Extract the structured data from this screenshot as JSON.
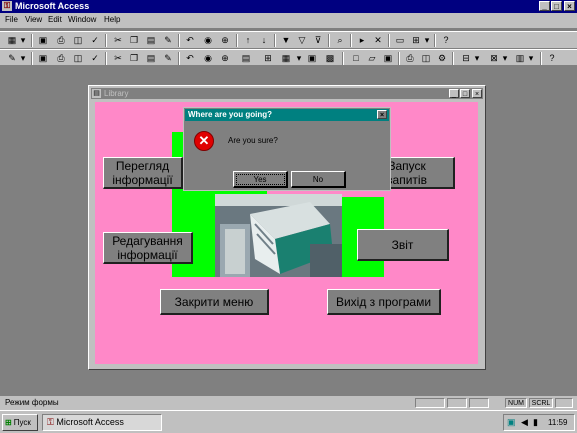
{
  "app": {
    "title": "Microsoft Access",
    "window_buttons": [
      "_",
      "□",
      "×"
    ]
  },
  "menu": [
    "File",
    "View",
    "Edit",
    "Window",
    "Help"
  ],
  "toolbar1": [
    "grid-view-icon",
    "save-icon",
    "print-icon",
    "print-preview-icon",
    "spell-check-icon",
    "cut-icon",
    "copy-icon",
    "paste-icon",
    "format-painter-icon",
    "undo-icon",
    "insert-object-icon",
    "insert-hyperlink-icon",
    "sort-ascending-icon",
    "sort-descending-icon",
    "filter-selection-icon",
    "filter-form-icon",
    "apply-filter-icon",
    "find-icon",
    "new-record-icon",
    "delete-record-icon",
    "database-window-icon",
    "new-object-icon",
    "help-icon"
  ],
  "toolbar2": [
    "design-view-icon",
    "save-icon",
    "print-icon",
    "print-preview-icon",
    "spell-check-icon",
    "cut-icon",
    "copy-icon",
    "paste-icon",
    "format-painter-icon",
    "undo-icon",
    "insert-hyperlink-icon",
    "web-toolbar-icon",
    "field-list-icon",
    "toolbox-icon",
    "autoformat-icon",
    "code-icon",
    "properties-icon",
    "build-icon",
    "new-icon",
    "open-icon",
    "save-icon",
    "print-icon",
    "preview-icon",
    "tool-icon",
    "relationships-icon",
    "analyze-icon",
    "office-links-icon",
    "help-icon"
  ],
  "library": {
    "title": "Library",
    "buttons": {
      "view_info": "Перегляд\nінформації",
      "run_queries": "Запуск\nзапитів",
      "edit_info": "Редагування\nінформації",
      "reports": "Звіт",
      "close_menu": "Закрити меню",
      "exit_program": "Вихід з програми"
    }
  },
  "dialog": {
    "title": "Where are you going?",
    "message": "Are you sure?",
    "yes_label": "Yes",
    "no_label": "No",
    "close_label": "×"
  },
  "statusbar": {
    "text": "Режим формы",
    "panels": [
      "",
      "",
      "",
      "NUM",
      "SCRL",
      ""
    ]
  },
  "taskbar": {
    "start_label": "Пуск",
    "task_label": "Microsoft Access",
    "clock": "11:59"
  },
  "colors": {
    "form_bg": "#ff88c8",
    "accent_green": "#00ff00",
    "titlebar": "#000080",
    "dialog_title": "#008080",
    "error_red": "#e00000"
  }
}
